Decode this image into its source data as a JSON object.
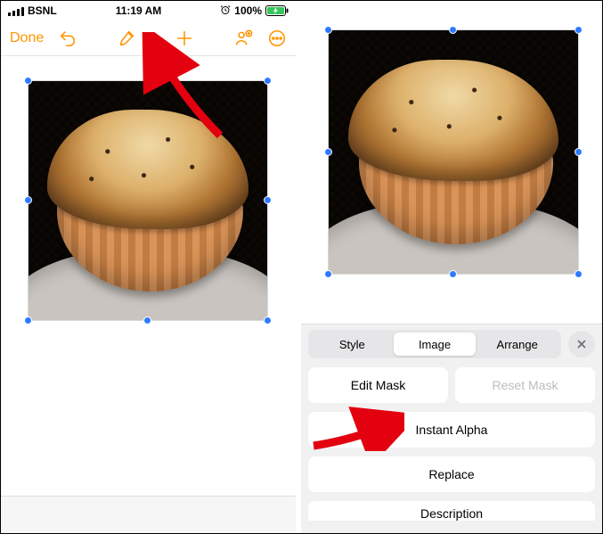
{
  "status": {
    "carrier": "BSNL",
    "time": "11:19 AM",
    "battery": "100%"
  },
  "toolbar": {
    "done_label": "Done",
    "undo_label": "Undo",
    "brush_label": "Format",
    "plus_label": "Insert",
    "collab_label": "Collaborate",
    "more_label": "More"
  },
  "format_panel": {
    "tabs": {
      "style": "Style",
      "image": "Image",
      "arrange": "Arrange"
    },
    "active_tab": "Image",
    "edit_mask": "Edit Mask",
    "reset_mask": "Reset Mask",
    "instant_alpha": "Instant Alpha",
    "replace": "Replace",
    "description": "Description"
  },
  "selection": {
    "object": "muffin-photo",
    "has_handles": true
  }
}
